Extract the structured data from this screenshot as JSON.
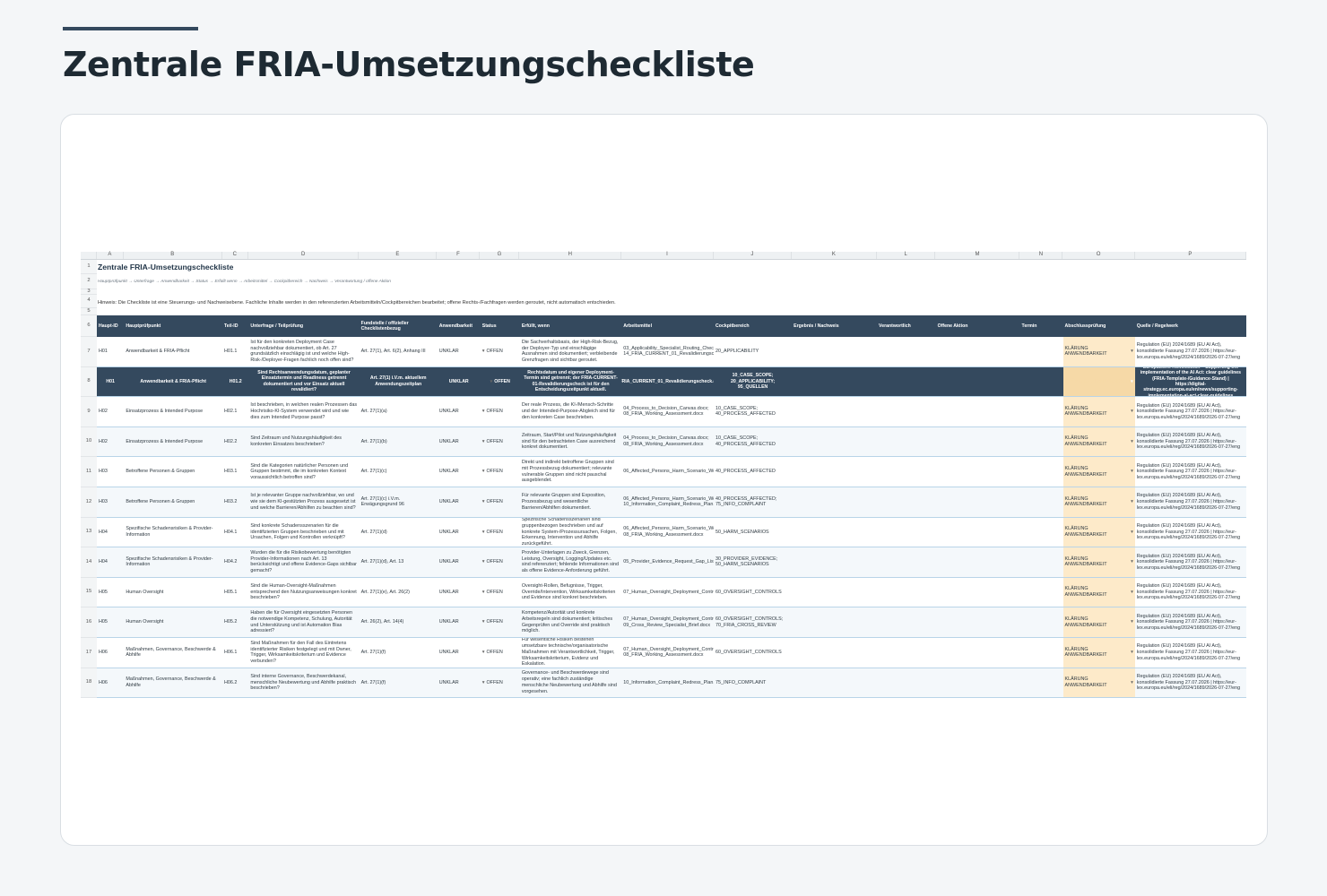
{
  "page": {
    "title": "Zentrale FRIA-Umsetzungscheckliste"
  },
  "sheet": {
    "columns": [
      "A",
      "B",
      "C",
      "D",
      "E",
      "F",
      "G",
      "H",
      "I",
      "J",
      "K",
      "L",
      "M",
      "N",
      "O",
      "P"
    ],
    "row_numbers": [
      "1",
      "2",
      "3",
      "4",
      "5",
      "6",
      "7",
      "8",
      "9",
      "10",
      "11",
      "12",
      "13",
      "14",
      "15",
      "16",
      "17",
      "18"
    ],
    "title": "Zentrale FRIA-Umsetzungscheckliste",
    "breadcrumb": "Hauptprüfpunkt → Unterfrage → Anwendbarkeit → Status → Erfüllt wenn → Arbeitsmittel → Cockpitbereich → Nachweis → Verantwortung / offene Aktion",
    "hint": "Hinweis: Die Checkliste ist eine Steuerungs- und Nachweisebene. Fachliche Inhalte werden in den referenzierten Arbeitsmitteln/Cockpitbereichen bearbeitet; offene Rechts-/Fachfragen werden geroutet, nicht automatisch entschieden.",
    "headers": [
      "Haupt-ID",
      "Hauptprüfpunkt",
      "Teil-ID",
      "Unterfrage / Teilprüfung",
      "Fundstelle / offizieller Checklistenbezug",
      "Anwendbarkeit",
      "Status",
      "Erfüllt, wenn",
      "Arbeitsmittel",
      "Cockpitbereich",
      "Ergebnis / Nachweis",
      "Verantwortlich",
      "Offene Aktion",
      "Termin",
      "Abschlussprüfung",
      "Quelle / Regelwerk"
    ],
    "rows": [
      {
        "id": "H01",
        "main": "Anwendbarkeit & FRIA-Pflicht",
        "sub": "H01.1",
        "question": "Ist für den konkreten Deployment Case nachvollziehbar dokumentiert, ob Art. 27 grundsätzlich einschlägig ist und welche High-Risk-/Deployer-Fragen fachlich noch offen sind?",
        "ref": "Art. 27(1), Art. 6(2), Anhang III",
        "app": "UNKLAR",
        "status": "OFFEN",
        "fulfilled": "Die Sachverhaltsbasis, der High-Risk-Bezug, der Deployer-Typ und einschlägige Ausnahmen sind dokumentiert; verbleibende Grenzfragen sind sichtbar geroutet.",
        "tools": "03_Applicability_Specialist_Routing_Check.docx; 14_FRIA_CURRENT_01_Revalidierungscheck.docx",
        "cockpit": "20_APPLICABILITY",
        "check": "KLÄRUNG ANWENDBARKEIT",
        "source": "Regulation (EU) 2024/1689 (EU AI Act), konsolidierte Fassung 27.07.2026 | https://eur-lex.europa.eu/eli/reg/2024/1689/2026-07-27/eng"
      },
      {
        "id": "H01",
        "main": "Anwendbarkeit & FRIA-Pflicht",
        "sub": "H01.2",
        "question": "Sind Rechtsanwendungsdatum, geplanter Einsatztermin und Readiness getrennt dokumentiert und vor Einsatz aktuell revalidiert?",
        "ref": "Art. 27(1) i.V.m. aktuellem Anwendungszeitplan",
        "app": "UNKLAR",
        "status": "OFFEN",
        "fulfilled": "Rechtsdatum und eigener Deployment-Termin sind getrennt; der FRIA-CURRENT-01-Revalidierungscheck ist für den Entscheidungszeitpunkt aktuell.",
        "tools": "14_FRIA_CURRENT_01_Revalidierungscheck.docx",
        "cockpit": "10_CASE_SCOPE; 20_APPLICABILITY; 95_QUELLEN",
        "check": "KLÄRUNG ANWENDBARKEIT",
        "source": "Europäische Kommission – Supporting the implementation of the AI Act: clear guidelines (FRIA-Template-/Guidance-Stand) | https://digital-strategy.ec.europa.eu/en/news/supporting-implementation-ai-act-clear-guidelines"
      },
      {
        "id": "H02",
        "main": "Einsatzprozess & Intended Purpose",
        "sub": "H02.1",
        "question": "Ist beschrieben, in welchen realen Prozessen das Hochrisiko-KI-System verwendet wird und wie dies zum Intended Purpose passt?",
        "ref": "Art. 27(1)(a)",
        "app": "UNKLAR",
        "status": "OFFEN",
        "fulfilled": "Der reale Prozess, die KI-/Mensch-Schritte und der Intended-Purpose-Abgleich sind für den konkreten Case beschrieben.",
        "tools": "04_Process_to_Decision_Canvas.docx; 08_FRIA_Working_Assessment.docx",
        "cockpit": "10_CASE_SCOPE; 40_PROCESS_AFFECTED",
        "check": "KLÄRUNG ANWENDBARKEIT",
        "source": "Regulation (EU) 2024/1689 (EU AI Act), konsolidierte Fassung 27.07.2026 | https://eur-lex.europa.eu/eli/reg/2024/1689/2026-07-27/eng"
      },
      {
        "id": "H02",
        "main": "Einsatzprozess & Intended Purpose",
        "sub": "H02.2",
        "question": "Sind Zeitraum und Nutzungshäufigkeit des konkreten Einsatzes beschrieben?",
        "ref": "Art. 27(1)(b)",
        "app": "UNKLAR",
        "status": "OFFEN",
        "fulfilled": "Zeitraum, Start/Pilot und Nutzungshäufigkeit sind für den betrachteten Case ausreichend konkret dokumentiert.",
        "tools": "04_Process_to_Decision_Canvas.docx; 08_FRIA_Working_Assessment.docx",
        "cockpit": "10_CASE_SCOPE; 40_PROCESS_AFFECTED",
        "check": "KLÄRUNG ANWENDBARKEIT",
        "source": "Regulation (EU) 2024/1689 (EU AI Act), konsolidierte Fassung 27.07.2026 | https://eur-lex.europa.eu/eli/reg/2024/1689/2026-07-27/eng"
      },
      {
        "id": "H03",
        "main": "Betroffene Personen & Gruppen",
        "sub": "H03.1",
        "question": "Sind die Kategorien natürlicher Personen und Gruppen bestimmt, die im konkreten Kontext voraussichtlich betroffen sind?",
        "ref": "Art. 27(1)(c)",
        "app": "UNKLAR",
        "status": "OFFEN",
        "fulfilled": "Direkt und indirekt betroffene Gruppen sind mit Prozessbezug dokumentiert; relevante vulnerable Gruppen sind nicht pauschal ausgeblendet.",
        "tools": "06_Affected_Persons_Harm_Scenario_Workshop.docx",
        "cockpit": "40_PROCESS_AFFECTED",
        "check": "KLÄRUNG ANWENDBARKEIT",
        "source": "Regulation (EU) 2024/1689 (EU AI Act), konsolidierte Fassung 27.07.2026 | https://eur-lex.europa.eu/eli/reg/2024/1689/2026-07-27/eng"
      },
      {
        "id": "H03",
        "main": "Betroffene Personen & Gruppen",
        "sub": "H03.2",
        "question": "Ist je relevanter Gruppe nachvollziehbar, wo und wie sie dem KI-gestützten Prozess ausgesetzt ist und welche Barrieren/Abhilfen zu beachten sind?",
        "ref": "Art. 27(1)(c) i.V.m. Erwägungsgrund 96",
        "app": "UNKLAR",
        "status": "OFFEN",
        "fulfilled": "Für relevante Gruppen sind Exposition, Prozessbezug und wesentliche Barrieren/Abhilfen dokumentiert.",
        "tools": "06_Affected_Persons_Harm_Scenario_Workshop.docx; 10_Information_Complaint_Redress_Plan.docx",
        "cockpit": "40_PROCESS_AFFECTED; 75_INFO_COMPLAINT",
        "check": "KLÄRUNG ANWENDBARKEIT",
        "source": "Regulation (EU) 2024/1689 (EU AI Act), konsolidierte Fassung 27.07.2026 | https://eur-lex.europa.eu/eli/reg/2024/1689/2026-07-27/eng"
      },
      {
        "id": "H04",
        "main": "Spezifische Schadensrisiken & Provider-Information",
        "sub": "H04.1",
        "question": "Sind konkrete Schadensszenarien für die identifizierten Gruppen beschrieben und mit Ursachen, Folgen und Kontrollen verknüpft?",
        "ref": "Art. 27(1)(d)",
        "app": "UNKLAR",
        "status": "OFFEN",
        "fulfilled": "Spezifische Schadensszenarien sind gruppenbezogen beschrieben und auf konkrete System-/Prozessursachen, Folgen, Erkennung, Intervention und Abhilfe zurückgeführt.",
        "tools": "06_Affected_Persons_Harm_Scenario_Workshop.docx; 08_FRIA_Working_Assessment.docx",
        "cockpit": "50_HARM_SCENARIOS",
        "check": "KLÄRUNG ANWENDBARKEIT",
        "source": "Regulation (EU) 2024/1689 (EU AI Act), konsolidierte Fassung 27.07.2026 | https://eur-lex.europa.eu/eli/reg/2024/1689/2026-07-27/eng"
      },
      {
        "id": "H04",
        "main": "Spezifische Schadensrisiken & Provider-Information",
        "sub": "H04.2",
        "question": "Wurden die für die Risikobewertung benötigten Provider-Informationen nach Art. 13 berücksichtigt und offene Evidence-Gaps sichtbar gemacht?",
        "ref": "Art. 27(1)(d), Art. 13",
        "app": "UNKLAR",
        "status": "OFFEN",
        "fulfilled": "Provider-Unterlagen zu Zweck, Grenzen, Leistung, Oversight, Logging/Updates etc. sind referenziert; fehlende Informationen sind als offene Evidence-Anforderung geführt.",
        "tools": "05_Provider_Evidence_Request_Gap_List.docx",
        "cockpit": "30_PROVIDER_EVIDENCE; 50_HARM_SCENARIOS",
        "check": "KLÄRUNG ANWENDBARKEIT",
        "source": "Regulation (EU) 2024/1689 (EU AI Act), konsolidierte Fassung 27.07.2026 | https://eur-lex.europa.eu/eli/reg/2024/1689/2026-07-27/eng"
      },
      {
        "id": "H05",
        "main": "Human Oversight",
        "sub": "H05.1",
        "question": "Sind die Human-Oversight-Maßnahmen entsprechend den Nutzungsanweisungen konkret beschrieben?",
        "ref": "Art. 27(1)(e), Art. 26(2)",
        "app": "UNKLAR",
        "status": "OFFEN",
        "fulfilled": "Oversight-Rollen, Befugnisse, Trigger, Override/Intervention, Wirksamkeitskriterien und Evidence sind konkret beschrieben.",
        "tools": "07_Human_Oversight_Deployment_Control_Plan.docx",
        "cockpit": "60_OVERSIGHT_CONTROLS",
        "check": "KLÄRUNG ANWENDBARKEIT",
        "source": "Regulation (EU) 2024/1689 (EU AI Act), konsolidierte Fassung 27.07.2026 | https://eur-lex.europa.eu/eli/reg/2024/1689/2026-07-27/eng"
      },
      {
        "id": "H05",
        "main": "Human Oversight",
        "sub": "H05.2",
        "question": "Haben die für Oversight eingesetzten Personen die notwendige Kompetenz, Schulung, Autorität und Unterstützung und ist Automation Bias adressiert?",
        "ref": "Art. 26(2), Art. 14(4)",
        "app": "UNKLAR",
        "status": "OFFEN",
        "fulfilled": "Kompetenz/Autorität und konkrete Arbeitsregeln sind dokumentiert; kritisches Gegenprüfen und Override sind praktisch möglich.",
        "tools": "07_Human_Oversight_Deployment_Control_Plan.docx; 09_Cross_Review_Specialist_Brief.docx",
        "cockpit": "60_OVERSIGHT_CONTROLS; 70_FRIA_CROSS_REVIEW",
        "check": "KLÄRUNG ANWENDBARKEIT",
        "source": "Regulation (EU) 2024/1689 (EU AI Act), konsolidierte Fassung 27.07.2026 | https://eur-lex.europa.eu/eli/reg/2024/1689/2026-07-27/eng"
      },
      {
        "id": "H06",
        "main": "Maßnahmen, Governance, Beschwerde & Abhilfe",
        "sub": "H06.1",
        "question": "Sind Maßnahmen für den Fall des Eintretens identifizierter Risiken festgelegt und mit Owner, Trigger, Wirksamkeitskriterium und Evidence verbunden?",
        "ref": "Art. 27(1)(f)",
        "app": "UNKLAR",
        "status": "OFFEN",
        "fulfilled": "Für wesentliche Risiken bestehen umsetzbare technische/organisatorische Maßnahmen mit Verantwortlichkeit, Trigger, Wirksamkeitskriterium, Evidenz und Eskalation.",
        "tools": "07_Human_Oversight_Deployment_Control_Plan.docx; 08_FRIA_Working_Assessment.docx",
        "cockpit": "60_OVERSIGHT_CONTROLS",
        "check": "KLÄRUNG ANWENDBARKEIT",
        "source": "Regulation (EU) 2024/1689 (EU AI Act), konsolidierte Fassung 27.07.2026 | https://eur-lex.europa.eu/eli/reg/2024/1689/2026-07-27/eng"
      },
      {
        "id": "H06",
        "main": "Maßnahmen, Governance, Beschwerde & Abhilfe",
        "sub": "H06.2",
        "question": "Sind interne Governance, Beschwerdekanal, menschliche Neubewertung und Abhilfe praktisch beschrieben?",
        "ref": "Art. 27(1)(f)",
        "app": "UNKLAR",
        "status": "OFFEN",
        "fulfilled": "Governance- und Beschwerdewege sind operativ; eine fachlich zuständige menschliche Neubewertung und Abhilfe sind vorgesehen.",
        "tools": "10_Information_Complaint_Redress_Plan.docx",
        "cockpit": "75_INFO_COMPLAINT",
        "check": "KLÄRUNG ANWENDBARKEIT",
        "source": "Regulation (EU) 2024/1689 (EU AI Act), konsolidierte Fassung 27.07.2026 | https://eur-lex.europa.eu/eli/reg/2024/1689/2026-07-27/eng"
      }
    ]
  }
}
